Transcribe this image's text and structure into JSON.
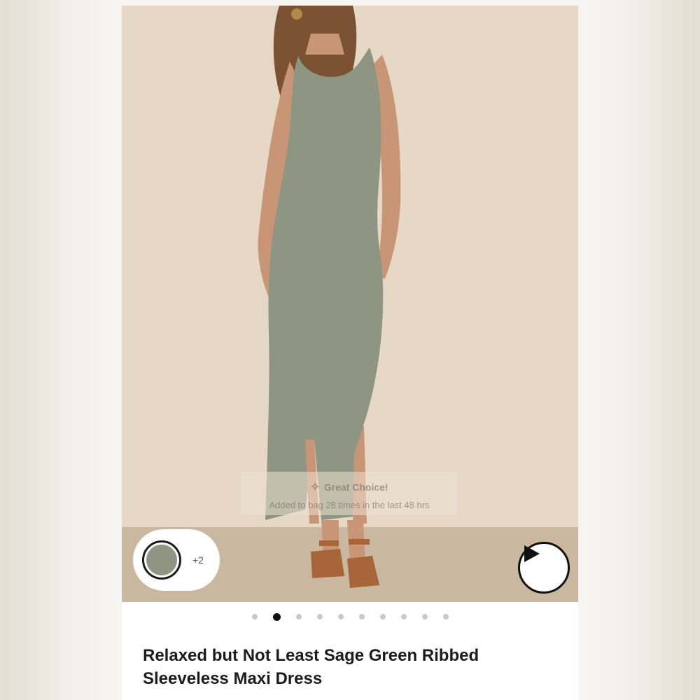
{
  "product": {
    "title_line1": "Relaxed but Not Least Sage Green Ribbed",
    "title_line2": "Sleeveless Maxi Dress"
  },
  "toast": {
    "title": "Great Choice!",
    "subtitle": "Added to bag 28 times in the last 48 hrs",
    "icon": "sparkle-icon"
  },
  "swatches": {
    "selected_color": "#8e9683",
    "more_label": "+2"
  },
  "video": {
    "icon": "play-icon"
  },
  "carousel": {
    "total": 10,
    "active_index": 1
  },
  "colors": {
    "backdrop": "#e7d8c5",
    "dress": "#8e9683",
    "accent": "#111111"
  }
}
